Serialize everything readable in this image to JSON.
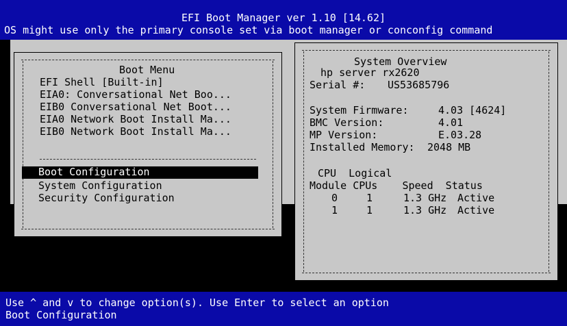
{
  "header": {
    "title": "EFI Boot Manager ver 1.10 [14.62]",
    "notice": "OS might use only the primary console set via boot manager or conconfig command"
  },
  "boot_menu": {
    "title": "Boot Menu",
    "items": [
      "EFI Shell [Built-in]",
      "EIA0: Conversational Net Boo...",
      "EIB0 Conversational Net Boot...",
      "EIA0 Network Boot Install Ma...",
      "EIB0 Network Boot Install Ma..."
    ],
    "config_items": [
      "Boot Configuration",
      "System Configuration",
      "Security Configuration"
    ],
    "selected": "Boot Configuration"
  },
  "system_overview": {
    "title": "System Overview",
    "model": "hp server rx2620",
    "serial_label": "Serial #:",
    "serial_value": "US53685796",
    "firmware_label": "System Firmware:",
    "firmware_value": "4.03 [4624]",
    "bmc_label": "BMC Version:",
    "bmc_value": "4.01",
    "mp_label": "MP Version:",
    "mp_value": "E.03.28",
    "memory_label": "Installed Memory:",
    "memory_value": "2048 MB",
    "cpu_header_line1": "CPU  Logical",
    "cpu_header_line2": "Module CPUs    Speed  Status",
    "cpu_rows": [
      {
        "module": "0",
        "cpus": "1",
        "speed": "1.3 GHz",
        "status": "Active"
      },
      {
        "module": "1",
        "cpus": "1",
        "speed": "1.3 GHz",
        "status": "Active"
      }
    ]
  },
  "footer": {
    "help": "Use ^ and v to change option(s). Use Enter to select an option",
    "status": "Boot Configuration"
  }
}
